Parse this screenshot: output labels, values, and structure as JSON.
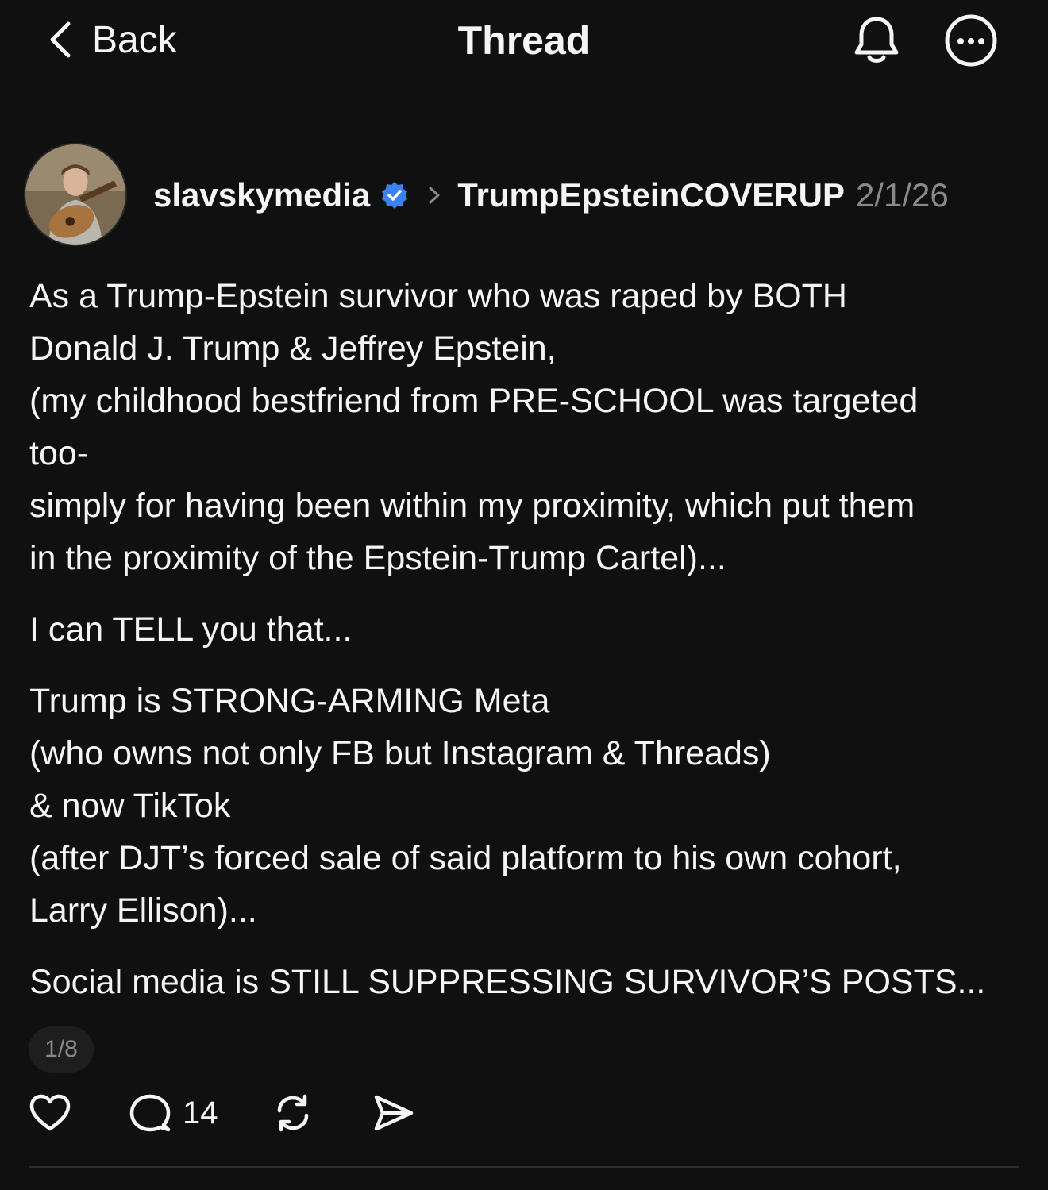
{
  "topbar": {
    "back_label": "Back",
    "title": "Thread",
    "icons": [
      "chevron-left-icon",
      "bell-icon",
      "more-icon"
    ]
  },
  "post": {
    "username": "slavskymedia",
    "verified": true,
    "community": "TrumpEpsteinCOVERUP",
    "date": "2/1/26",
    "paragraphs": [
      [
        "As a Trump-Epstein survivor who was raped by BOTH",
        "Donald J. Trump & Jeffrey Epstein,",
        "(my childhood bestfriend from PRE-SCHOOL was targeted",
        "too-",
        "simply for having been within my proximity, which put them",
        "in the proximity of the Epstein-Trump Cartel)..."
      ],
      [
        "I can TELL you that..."
      ],
      [
        "Trump is STRONG-ARMING Meta",
        "(who owns not only FB but Instagram & Threads)",
        "& now TikTok",
        "(after DJT’s forced sale of said platform to his own cohort,",
        "Larry Ellison)..."
      ],
      [
        "Social media is STILL SUPPRESSING SURVIVOR’S POSTS..."
      ]
    ],
    "page_indicator": "1/8",
    "reply_count": "14"
  },
  "colors": {
    "background": "#101010",
    "text": "#f3f5f7",
    "muted": "#8a8a8a",
    "verified_badge": "#3b82f6"
  }
}
